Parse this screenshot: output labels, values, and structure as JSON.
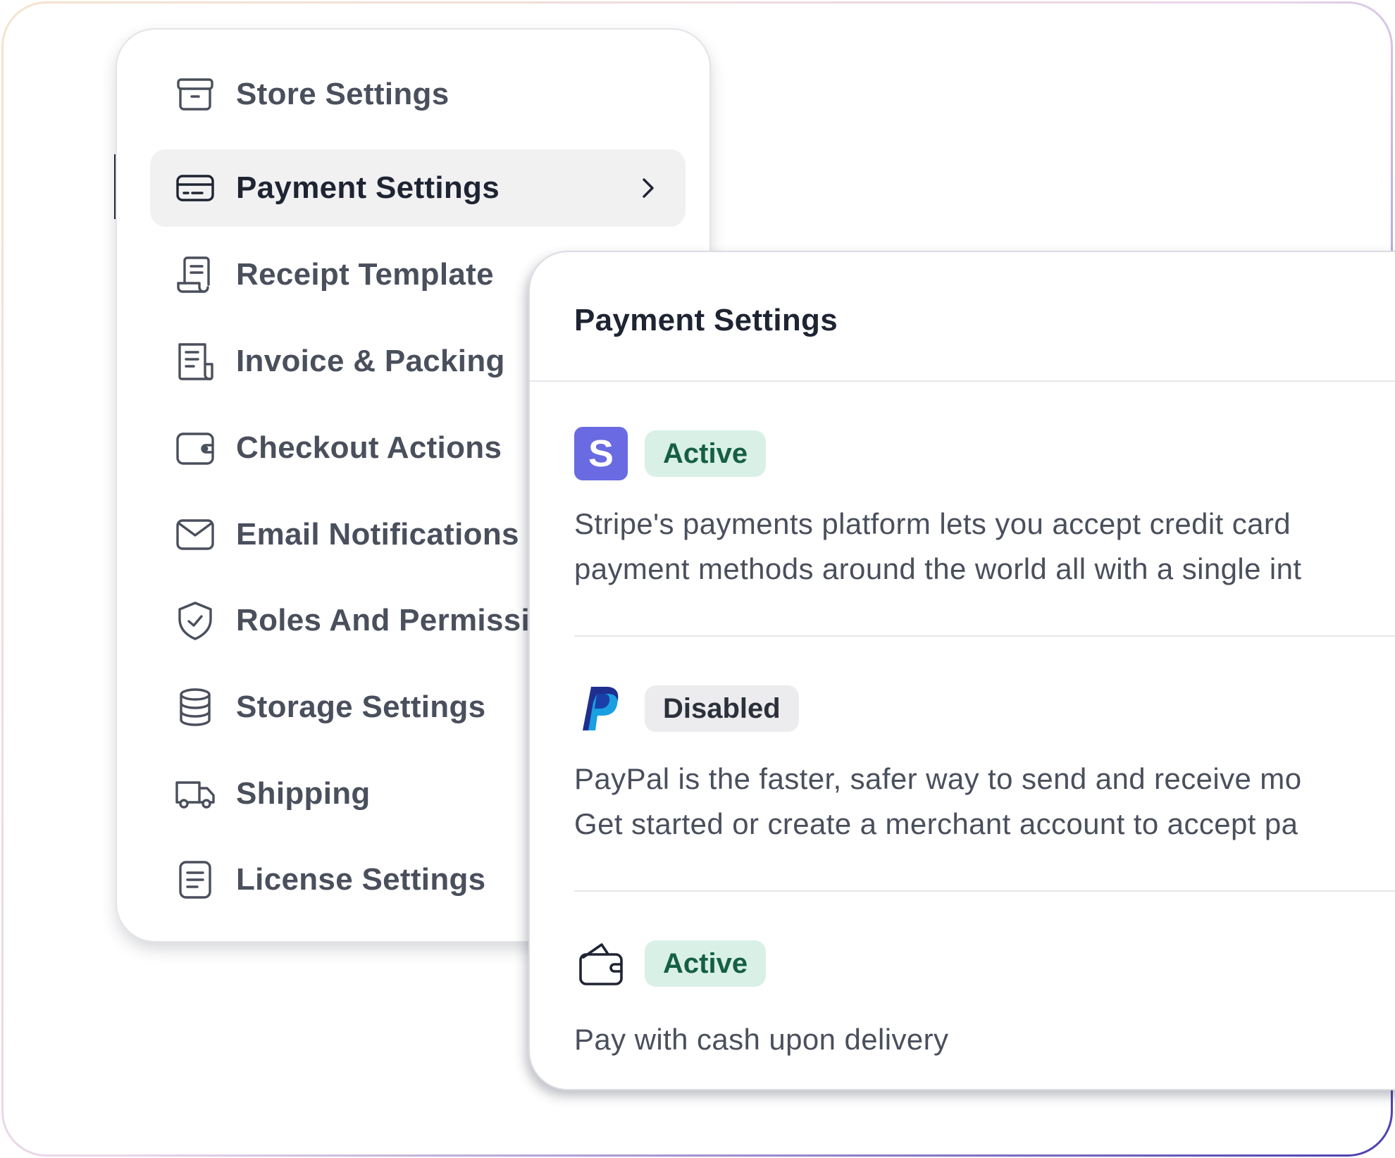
{
  "sidebar": {
    "items": [
      {
        "label": "Store Settings",
        "icon": "store-box-icon",
        "active": false
      },
      {
        "label": "Payment Settings",
        "icon": "credit-card-icon",
        "active": true
      },
      {
        "label": "Receipt Template",
        "icon": "receipt-icon",
        "active": false
      },
      {
        "label": "Invoice & Packing",
        "icon": "invoice-icon",
        "active": false
      },
      {
        "label": "Checkout Actions",
        "icon": "wallet-icon",
        "active": false
      },
      {
        "label": "Email Notifications",
        "icon": "envelope-icon",
        "active": false
      },
      {
        "label": "Roles And Permissions",
        "icon": "shield-check-icon",
        "active": false
      },
      {
        "label": "Storage Settings",
        "icon": "database-icon",
        "active": false
      },
      {
        "label": "Shipping",
        "icon": "truck-icon",
        "active": false
      },
      {
        "label": "License Settings",
        "icon": "document-icon",
        "active": false
      }
    ]
  },
  "panel": {
    "title": "Payment Settings",
    "methods": [
      {
        "logo": "stripe-logo",
        "logo_letter": "S",
        "status": "Active",
        "description_line1": "Stripe's payments platform lets you accept credit card",
        "description_line2": "payment methods around the world all with a single int"
      },
      {
        "logo": "paypal-logo",
        "status": "Disabled",
        "description_line1": "PayPal is the faster, safer way to send and receive mo",
        "description_line2": "Get started or create a merchant account to accept pa"
      },
      {
        "logo": "wallet-icon",
        "status": "Active",
        "description_line1": "Pay with cash upon delivery"
      }
    ]
  },
  "colors": {
    "active_badge_bg": "#d9f0e6",
    "active_badge_text": "#155f45",
    "disabled_badge_bg": "#ececee",
    "stripe_purple": "#6a6ae2",
    "paypal_dark_blue": "#1e2f8f",
    "paypal_light_blue": "#1a9fe0",
    "sidebar_active_bg": "#f1f1f2"
  }
}
